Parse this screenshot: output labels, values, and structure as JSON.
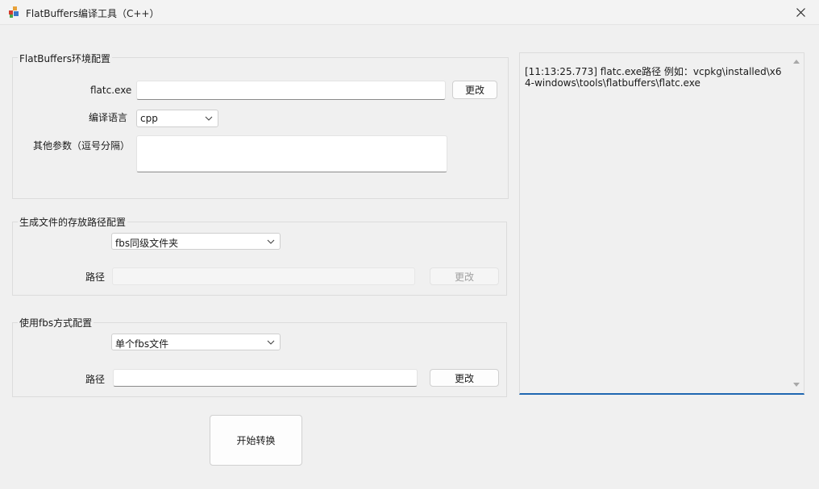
{
  "window": {
    "title": "FlatBuffers编译工具（C++）",
    "app_icon": "colored-blocks-icon",
    "close_icon": "close-icon"
  },
  "env_group": {
    "title": "FlatBuffers环境配置",
    "flatc_label": "flatc.exe",
    "flatc_value": "",
    "flatc_button": "更改",
    "lang_label": "编译语言",
    "lang_selected": "cpp",
    "params_label": "其他参数（逗号分隔）",
    "params_value": ""
  },
  "output_group": {
    "title": "生成文件的存放路径配置",
    "mode_selected": "fbs同级文件夹",
    "path_label": "路径",
    "path_value": "",
    "change_button": "更改"
  },
  "fbs_group": {
    "title": "使用fbs方式配置",
    "mode_selected": "单个fbs文件",
    "path_label": "路径",
    "path_value": "",
    "change_button": "更改"
  },
  "start_button": "开始转换",
  "log": {
    "text": "[11:13:25.773] flatc.exe路径 例如：vcpkg\\installed\\x64-windows\\tools\\flatbuffers\\flatc.exe"
  },
  "colors": {
    "accent": "#1f67b1",
    "background": "#f0f0f0"
  }
}
